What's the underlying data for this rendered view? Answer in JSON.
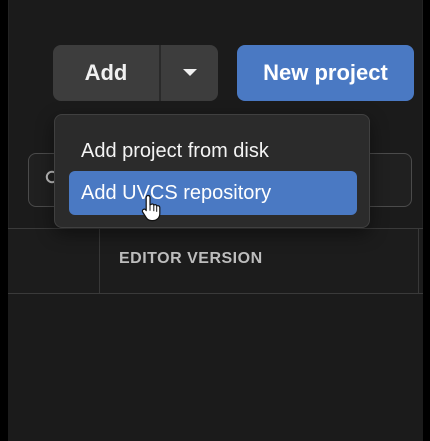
{
  "toolbar": {
    "add_label": "Add",
    "new_project_label": "New project"
  },
  "dropdown": {
    "items": [
      {
        "label": "Add project from disk"
      },
      {
        "label": "Add UVCS repository"
      }
    ]
  },
  "table": {
    "column_header": "EDITOR VERSION"
  },
  "icons": {
    "search": "search-icon",
    "dropdown": "chevron-down-icon",
    "cursor": "hand-pointer-icon"
  },
  "colors": {
    "background": "#1b1b1b",
    "primary": "#4a79c3",
    "button_gray": "#3d3d3d",
    "menu_bg": "#2b2b2b"
  }
}
